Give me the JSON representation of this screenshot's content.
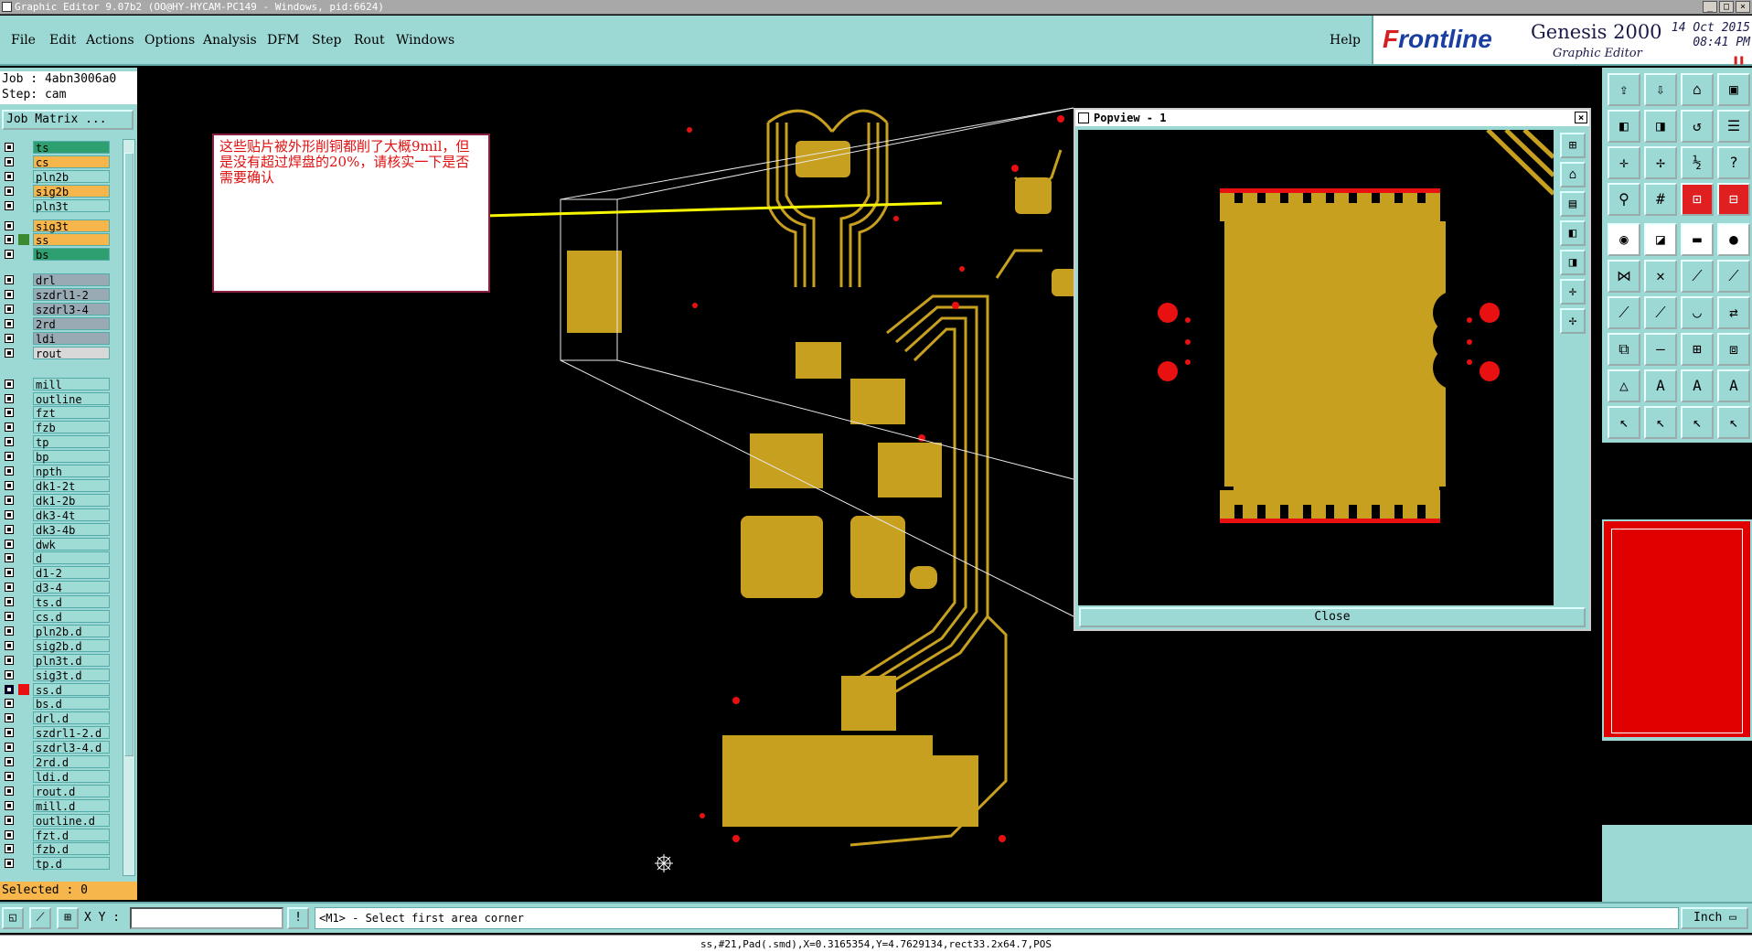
{
  "window": {
    "title": "Graphic Editor 9.07b2 (OO@HY-HYCAM-PC149 - Windows, pid:6624)"
  },
  "menu": {
    "items": [
      "File",
      "Edit",
      "Actions",
      "Options",
      "Analysis",
      "DFM",
      "Step",
      "Rout",
      "Windows"
    ],
    "help": "Help"
  },
  "brand": {
    "logo_a": "F",
    "logo_b": "rontline",
    "product": "Genesis 2000",
    "subtitle": "Graphic Editor",
    "date": "14 Oct 2015",
    "time": "08:41 PM"
  },
  "job": {
    "job_line": "Job : 4abn3006a0",
    "step_line": "Step: cam",
    "matrix_button": "Job Matrix ...",
    "selected": "Selected : 0"
  },
  "colors": {
    "copper": "#c8a020",
    "pad_red": "#e81010",
    "panel": "#9cd8d4",
    "orange_layer": "#f6b64c",
    "green_layer": "#2ea070",
    "grey_layer": "#9aaab4"
  },
  "layers": [
    {
      "name": "ts",
      "color": "green",
      "mark": ""
    },
    {
      "name": "cs",
      "color": "orange",
      "mark": ""
    },
    {
      "name": "pln2b",
      "color": "cyan",
      "mark": ""
    },
    {
      "name": "sig2b",
      "color": "orange",
      "mark": ""
    },
    {
      "name": "pln3t",
      "color": "cyan",
      "mark": ""
    },
    {
      "name": "sig3t",
      "color": "orange",
      "mark": ""
    },
    {
      "name": "ss",
      "color": "orange",
      "mark": "green"
    },
    {
      "name": "bs",
      "color": "green",
      "mark": ""
    },
    {
      "name": "drl",
      "color": "grey",
      "mark": ""
    },
    {
      "name": "szdrl1-2",
      "color": "grey",
      "mark": ""
    },
    {
      "name": "szdrl3-4",
      "color": "grey",
      "mark": ""
    },
    {
      "name": "2rd",
      "color": "grey",
      "mark": ""
    },
    {
      "name": "ldi",
      "color": "grey",
      "mark": ""
    },
    {
      "name": "rout",
      "color": "lightgrey",
      "mark": ""
    },
    {
      "name": "mill",
      "color": "cyan",
      "mark": ""
    },
    {
      "name": "outline",
      "color": "cyan",
      "mark": ""
    },
    {
      "name": "fzt",
      "color": "cyan",
      "mark": ""
    },
    {
      "name": "fzb",
      "color": "cyan",
      "mark": ""
    },
    {
      "name": "tp",
      "color": "cyan",
      "mark": ""
    },
    {
      "name": "bp",
      "color": "cyan",
      "mark": ""
    },
    {
      "name": "npth",
      "color": "cyan",
      "mark": ""
    },
    {
      "name": "dk1-2t",
      "color": "cyan",
      "mark": ""
    },
    {
      "name": "dk1-2b",
      "color": "cyan",
      "mark": ""
    },
    {
      "name": "dk3-4t",
      "color": "cyan",
      "mark": ""
    },
    {
      "name": "dk3-4b",
      "color": "cyan",
      "mark": ""
    },
    {
      "name": "dwk",
      "color": "cyan",
      "mark": ""
    },
    {
      "name": "d",
      "color": "cyan",
      "mark": ""
    },
    {
      "name": "d1-2",
      "color": "cyan",
      "mark": ""
    },
    {
      "name": "d3-4",
      "color": "cyan",
      "mark": ""
    },
    {
      "name": "ts.d",
      "color": "cyan",
      "mark": ""
    },
    {
      "name": "cs.d",
      "color": "cyan",
      "mark": ""
    },
    {
      "name": "pln2b.d",
      "color": "cyan",
      "mark": ""
    },
    {
      "name": "sig2b.d",
      "color": "cyan",
      "mark": ""
    },
    {
      "name": "pln3t.d",
      "color": "cyan",
      "mark": ""
    },
    {
      "name": "sig3t.d",
      "color": "cyan",
      "mark": ""
    },
    {
      "name": "ss.d",
      "color": "cyan",
      "mark": "red",
      "selected": true
    },
    {
      "name": "bs.d",
      "color": "cyan",
      "mark": ""
    },
    {
      "name": "drl.d",
      "color": "cyan",
      "mark": ""
    },
    {
      "name": "szdrl1-2.d",
      "color": "cyan",
      "mark": ""
    },
    {
      "name": "szdrl3-4.d",
      "color": "cyan",
      "mark": ""
    },
    {
      "name": "2rd.d",
      "color": "cyan",
      "mark": ""
    },
    {
      "name": "ldi.d",
      "color": "cyan",
      "mark": ""
    },
    {
      "name": "rout.d",
      "color": "cyan",
      "mark": ""
    },
    {
      "name": "mill.d",
      "color": "cyan",
      "mark": ""
    },
    {
      "name": "outline.d",
      "color": "cyan",
      "mark": ""
    },
    {
      "name": "fzt.d",
      "color": "cyan",
      "mark": ""
    },
    {
      "name": "fzb.d",
      "color": "cyan",
      "mark": ""
    },
    {
      "name": "tp.d",
      "color": "cyan",
      "mark": ""
    }
  ],
  "annotation": {
    "text": "这些贴片被外形削铜都削了大概9mil，但是没有超过焊盘的20%，请核实一下是否需要确认"
  },
  "popview": {
    "title": "Popview - 1",
    "close_label": "Close"
  },
  "command": {
    "xy_label": "X Y :",
    "xy_value": "",
    "message": "<M1> - Select first area corner",
    "units": "Inch"
  },
  "status": {
    "text": "ss,#21,Pad(.smd),X=0.3165354,Y=4.7629134,rect33.2x64.7,POS"
  }
}
